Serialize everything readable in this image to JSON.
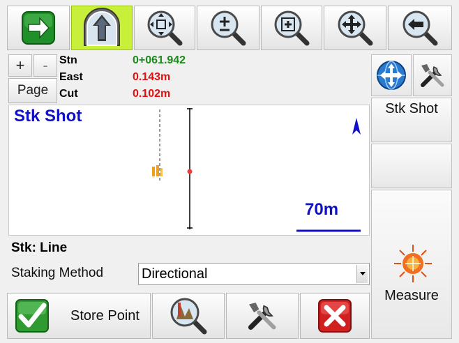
{
  "toolbar": {
    "icons": [
      "next-arrow-icon",
      "navigate-up-icon",
      "zoom-extents-icon",
      "zoom-in-out-icon",
      "zoom-window-icon",
      "pan-icon",
      "back-icon"
    ]
  },
  "page_controls": {
    "plus_label": "+",
    "minus_label": "-",
    "page_label": "Page"
  },
  "readout": {
    "rows": [
      {
        "label": "Stn",
        "value": "0+061.942",
        "color": "#1a8a1a"
      },
      {
        "label": "East",
        "value": "0.143m",
        "color": "#e01010"
      },
      {
        "label": "Cut",
        "value": "0.102m",
        "color": "#e01010"
      }
    ]
  },
  "map": {
    "title": "Stk Shot",
    "scale_label": "70m",
    "title_color": "#1010c8",
    "scale_color": "#1010c8"
  },
  "side": {
    "stk_shot_label": "Stk Shot",
    "measure_label": "Measure"
  },
  "staking": {
    "stk_label": "Stk: Line",
    "method_label": "Staking Method",
    "method_value": "Directional"
  },
  "bottom": {
    "store_point_label": "Store Point"
  }
}
